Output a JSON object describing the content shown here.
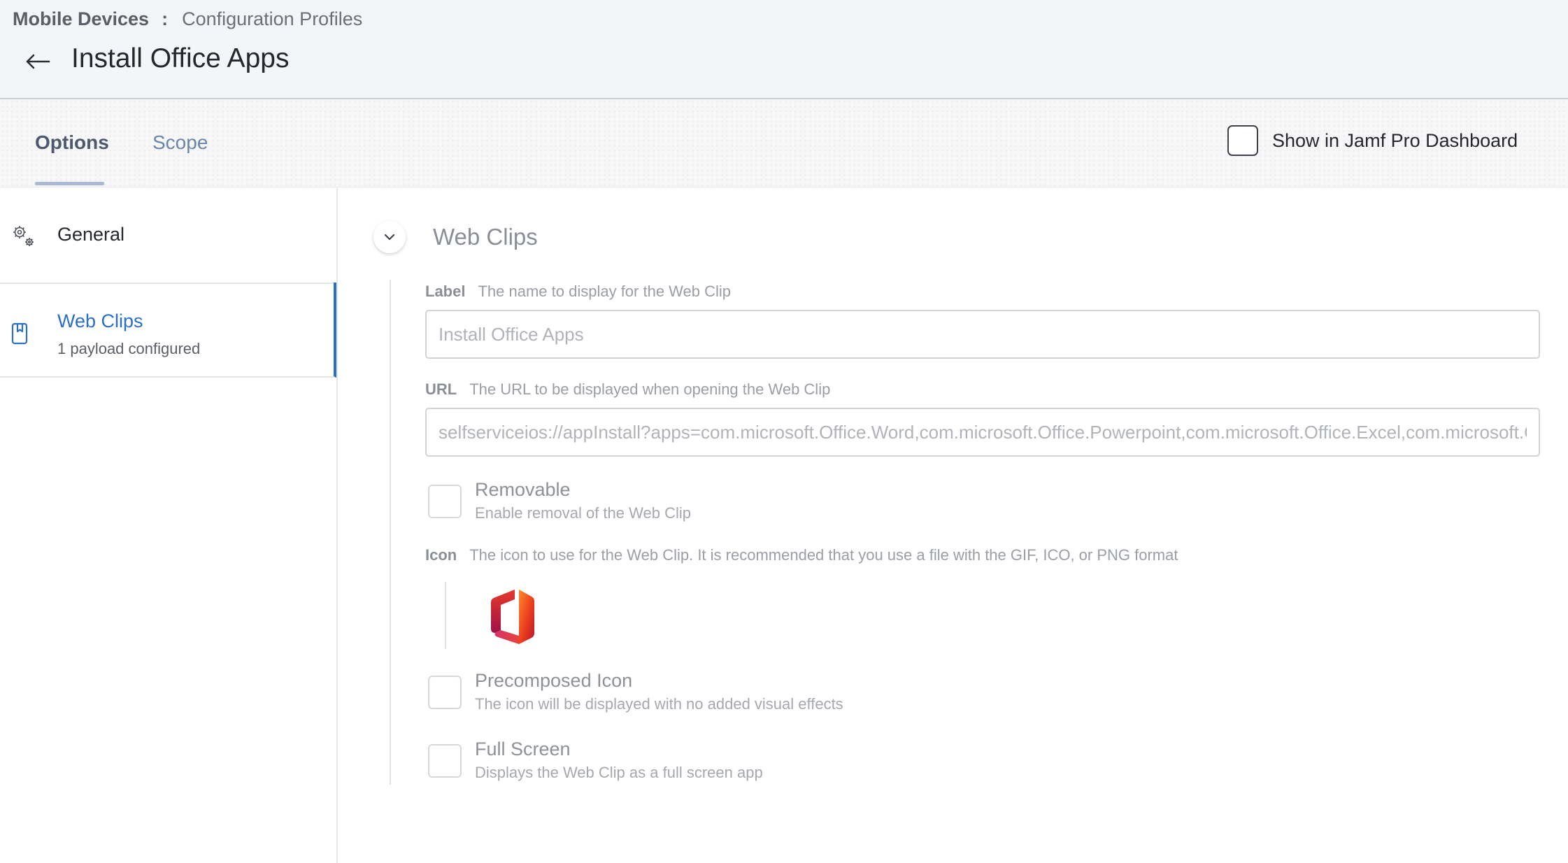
{
  "breadcrumb": {
    "root": "Mobile Devices",
    "separator": ":",
    "leaf": "Configuration Profiles"
  },
  "page": {
    "title": "Install Office Apps",
    "back_icon": "arrow-left-icon"
  },
  "tabs": [
    {
      "label": "Options",
      "active": true
    },
    {
      "label": "Scope",
      "active": false
    }
  ],
  "dashboard_toggle": {
    "label": "Show in Jamf Pro Dashboard",
    "checked": false
  },
  "sidebar": {
    "items": [
      {
        "label": "General",
        "icon": "gears-icon",
        "selected": false
      },
      {
        "label": "Web Clips",
        "sublabel": "1 payload configured",
        "icon": "web-clip-icon",
        "selected": true
      }
    ]
  },
  "section": {
    "title": "Web Clips",
    "expanded": true,
    "label_field": {
      "name": "Label",
      "description": "The name to display for the Web Clip",
      "value": "Install Office Apps"
    },
    "url_field": {
      "name": "URL",
      "description": "The URL to be displayed when opening the Web Clip",
      "value": "selfserviceios://appInstall?apps=com.microsoft.Office.Word,com.microsoft.Office.Powerpoint,com.microsoft.Office.Excel,com.microsoft.Office.Outlook"
    },
    "removable": {
      "title": "Removable",
      "description": "Enable removal of the Web Clip",
      "checked": false
    },
    "icon_field": {
      "name": "Icon",
      "description": "The icon to use for the Web Clip. It is recommended that you use a file with the GIF, ICO, or PNG format",
      "image": "microsoft-office-logo"
    },
    "precomposed": {
      "title": "Precomposed Icon",
      "description": "The icon will be displayed with no added visual effects",
      "checked": false
    },
    "full_screen": {
      "title": "Full Screen",
      "description": "Displays the Web Clip as a full screen app",
      "checked": false
    }
  },
  "colors": {
    "accent": "#2a6fc4",
    "tab_active": "#4d5a6d",
    "tab_inactive": "#6b86a8"
  }
}
